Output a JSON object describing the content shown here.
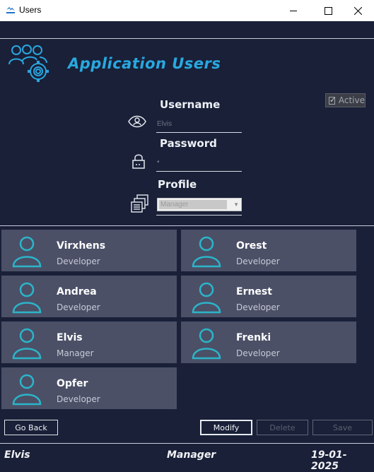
{
  "window": {
    "title": "Users",
    "minimize_icon": "minimize-icon",
    "maximize_icon": "maximize-icon",
    "close_icon": "close-icon"
  },
  "header": {
    "title": "Application Users",
    "icon": "users-gear-icon"
  },
  "form": {
    "active_label": "Active",
    "active_checked": true,
    "username_label": "Username",
    "username_value": "Elvis",
    "password_label": "Password",
    "password_value": "•",
    "profile_label": "Profile",
    "profile_value": "Manager"
  },
  "users": [
    {
      "name": "Virxhens",
      "role": "Developer"
    },
    {
      "name": "Orest",
      "role": "Developer"
    },
    {
      "name": "Andrea",
      "role": "Developer"
    },
    {
      "name": "Ernest",
      "role": "Developer"
    },
    {
      "name": "Elvis",
      "role": "Manager"
    },
    {
      "name": "Frenki",
      "role": "Developer"
    },
    {
      "name": "Opfer",
      "role": "Developer"
    }
  ],
  "buttons": {
    "go_back": "Go Back",
    "modify": "Modify",
    "delete": "Delete",
    "save": "Save"
  },
  "footer": {
    "user": "Elvis",
    "profile": "Manager",
    "date": "19-01-2025"
  },
  "colors": {
    "background": "#192038",
    "card": "#4b5067",
    "accent": "#29a8e0",
    "avatar": "#2bb5c9"
  }
}
